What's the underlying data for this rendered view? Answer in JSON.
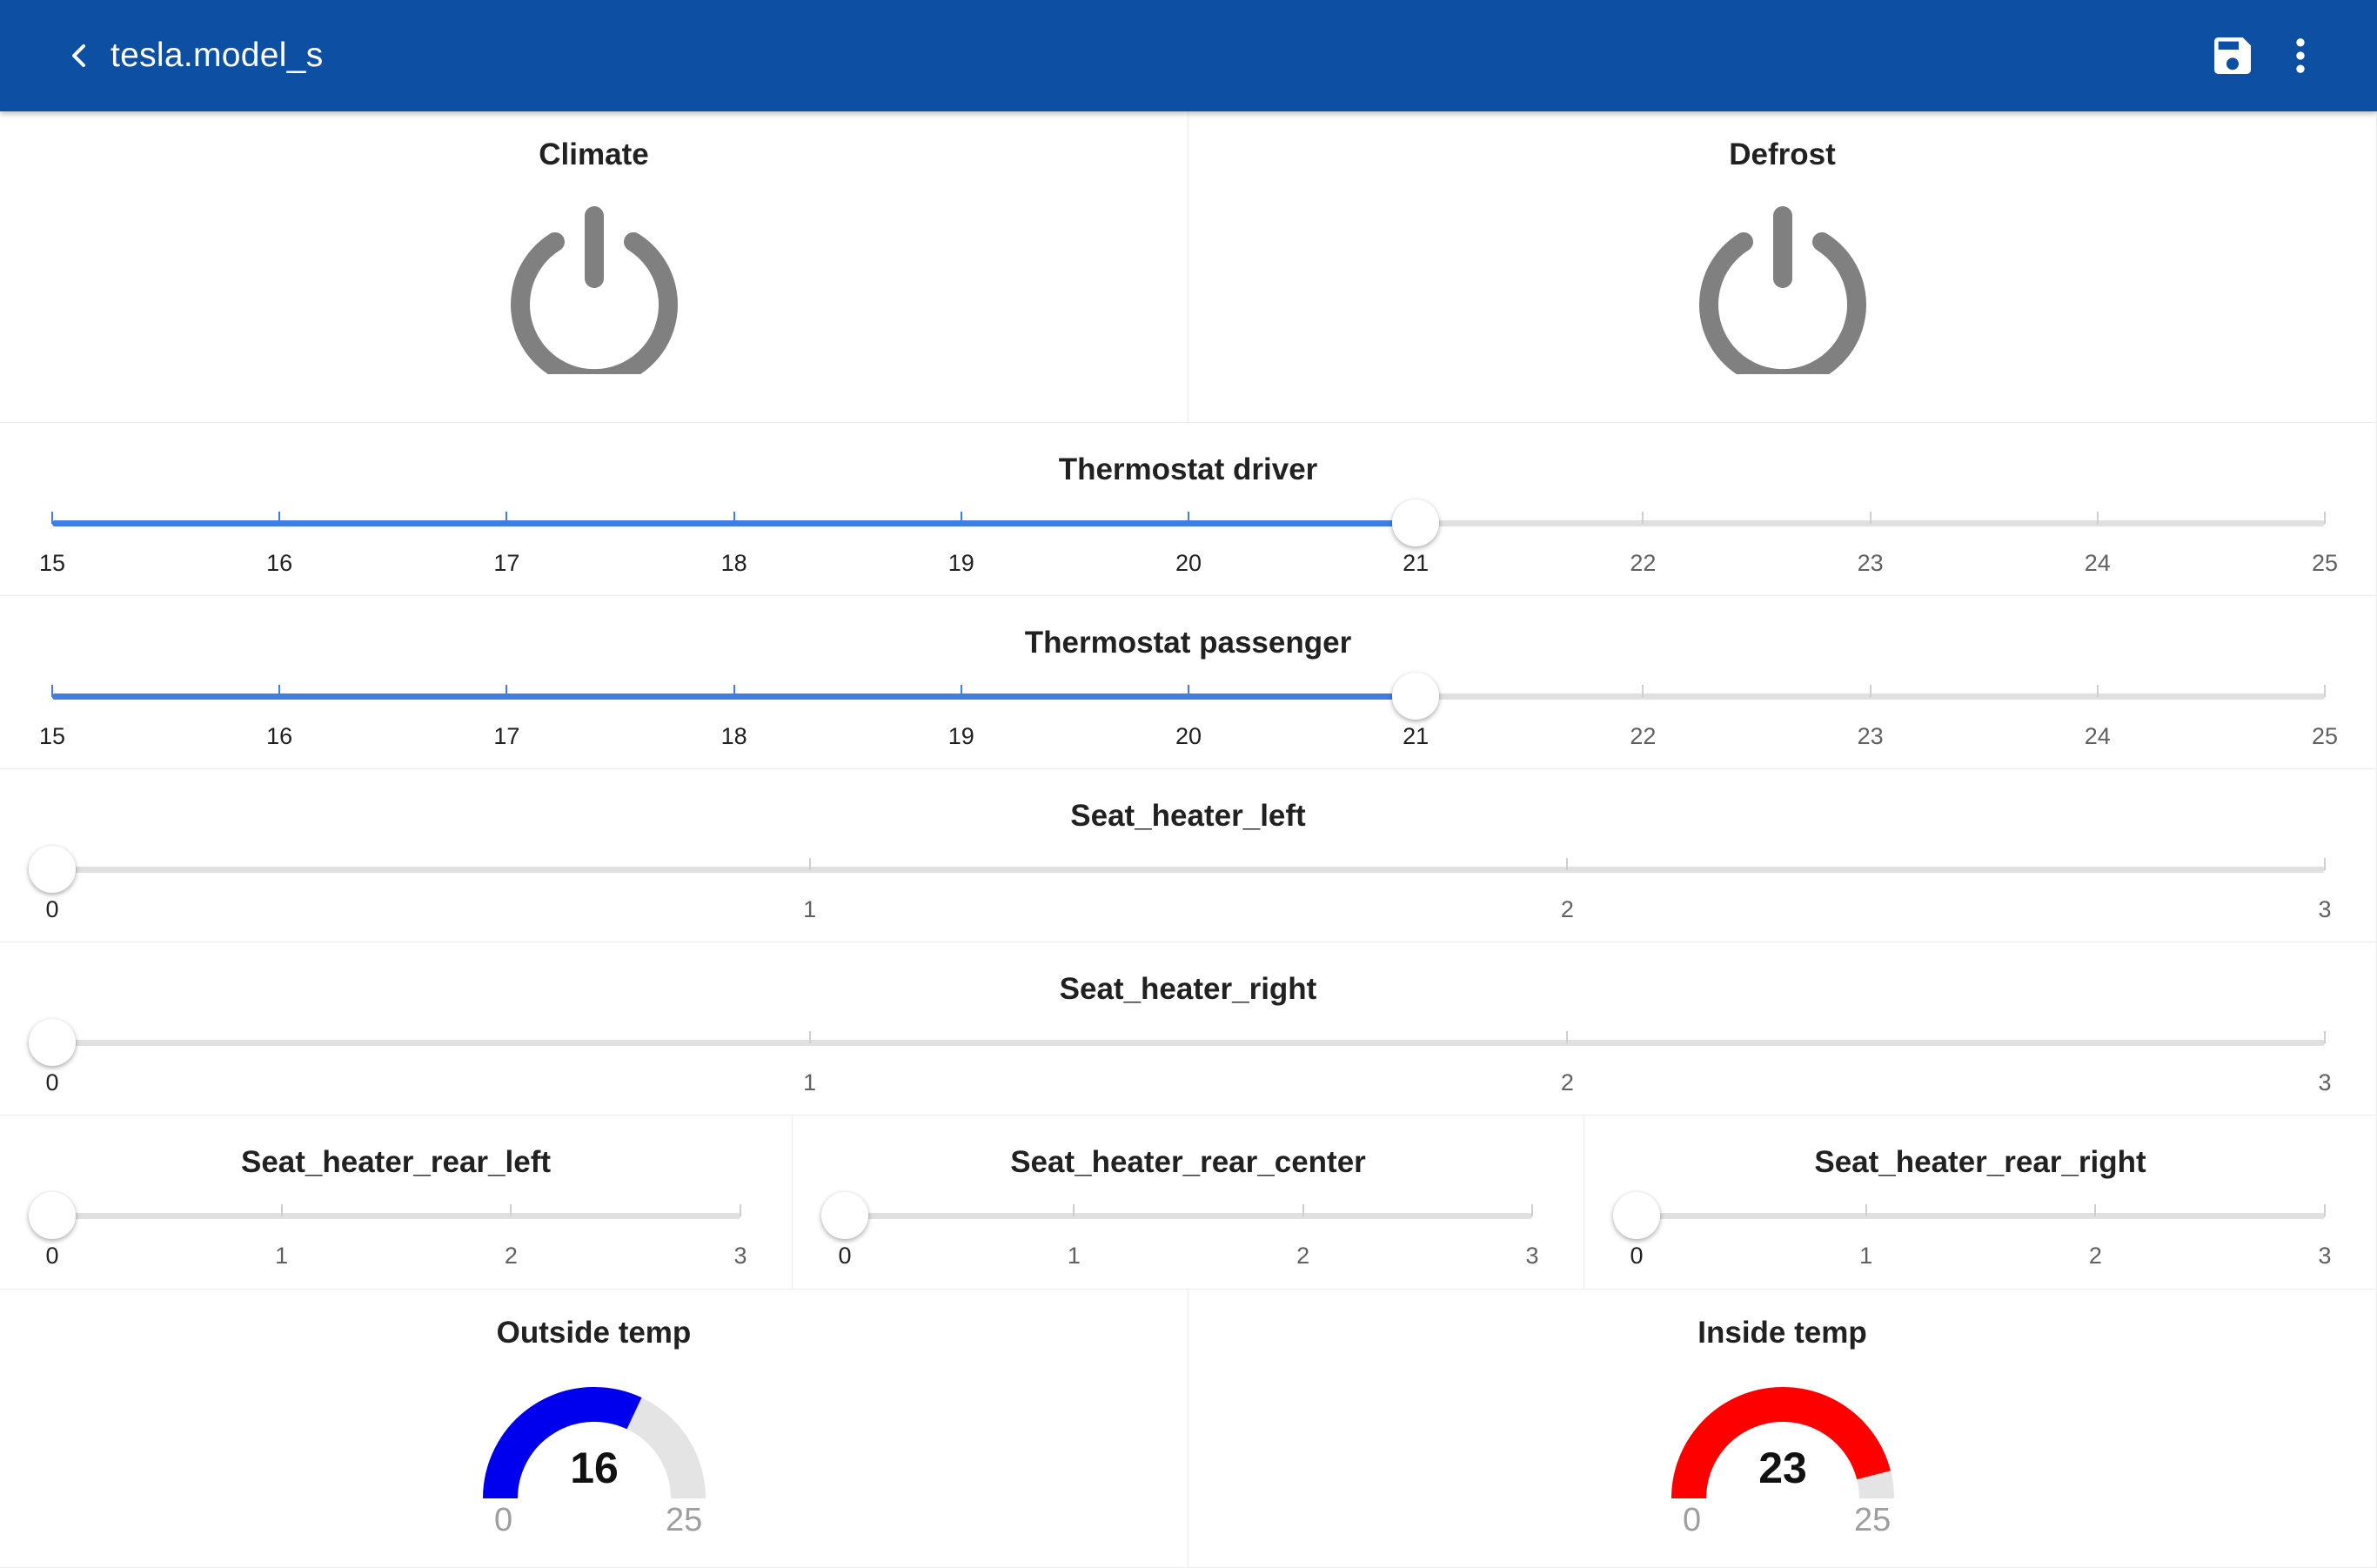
{
  "header": {
    "title": "tesla.model_s",
    "back_icon": "chevron-left-icon",
    "save_icon": "floppy-disk-icon",
    "more_icon": "more-vertical-icon",
    "background": "#0d4fa3"
  },
  "buttons": {
    "climate": {
      "title": "Climate",
      "icon": "power-icon",
      "color": "#808080"
    },
    "defrost": {
      "title": "Defrost",
      "icon": "power-icon",
      "color": "#808080"
    }
  },
  "sliders": {
    "thermostat_driver": {
      "title": "Thermostat driver",
      "min": 15,
      "max": 25,
      "value": 21,
      "labels": [
        "15",
        "16",
        "17",
        "18",
        "19",
        "20",
        "21",
        "22",
        "23",
        "24",
        "25"
      ]
    },
    "thermostat_passenger": {
      "title": "Thermostat passenger",
      "min": 15,
      "max": 25,
      "value": 21,
      "labels": [
        "15",
        "16",
        "17",
        "18",
        "19",
        "20",
        "21",
        "22",
        "23",
        "24",
        "25"
      ]
    },
    "seat_heater_left": {
      "title": "Seat_heater_left",
      "min": 0,
      "max": 3,
      "value": 0,
      "labels": [
        "0",
        "1",
        "2",
        "3"
      ]
    },
    "seat_heater_right": {
      "title": "Seat_heater_right",
      "min": 0,
      "max": 3,
      "value": 0,
      "labels": [
        "0",
        "1",
        "2",
        "3"
      ]
    },
    "seat_heater_rear_left": {
      "title": "Seat_heater_rear_left",
      "min": 0,
      "max": 3,
      "value": 0,
      "labels": [
        "0",
        "1",
        "2",
        "3"
      ]
    },
    "seat_heater_rear_center": {
      "title": "Seat_heater_rear_center",
      "min": 0,
      "max": 3,
      "value": 0,
      "labels": [
        "0",
        "1",
        "2",
        "3"
      ]
    },
    "seat_heater_rear_right": {
      "title": "Seat_heater_rear_right",
      "min": 0,
      "max": 3,
      "value": 0,
      "labels": [
        "0",
        "1",
        "2",
        "3"
      ]
    }
  },
  "gauges": {
    "outside_temp": {
      "title": "Outside temp",
      "value": 16,
      "min": 0,
      "max": 25,
      "value_text": "16",
      "min_text": "0",
      "max_text": "25",
      "color": "#0000ee",
      "track_color": "#e4e4e4"
    },
    "inside_temp": {
      "title": "Inside temp",
      "value": 23,
      "min": 0,
      "max": 25,
      "value_text": "23",
      "min_text": "0",
      "max_text": "25",
      "color": "#ff0000",
      "track_color": "#e4e4e4"
    }
  },
  "colors": {
    "accent": "#3f7fe5",
    "track": "#e0e0e0"
  }
}
